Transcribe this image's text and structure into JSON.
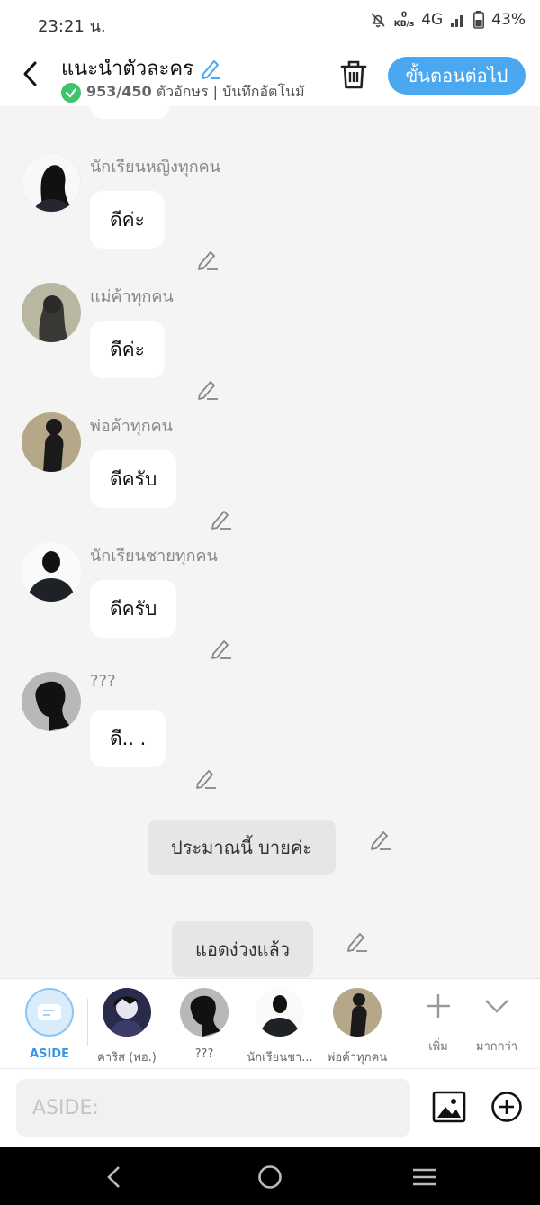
{
  "status": {
    "time": "23:21 น.",
    "speed_top": "0",
    "speed_bottom": "KB/s",
    "network": "4G",
    "battery": "43%"
  },
  "header": {
    "title": "แนะนำตัวละคร",
    "char_count": "953/450",
    "char_label": "ตัวอักษร",
    "autosave": "| บันทึกอัตโนมั",
    "next_label": "ขั้นตอนต่อไป"
  },
  "messages": [
    {
      "sender": "นักเรียนหญิงทุกคน",
      "text": "ดีค่ะ"
    },
    {
      "sender": "แม่ค้าทุกคน",
      "text": "ดีค่ะ"
    },
    {
      "sender": "พ่อค้าทุกคน",
      "text": "ดีครับ"
    },
    {
      "sender": "นักเรียนชายทุกคน",
      "text": "ดีครับ"
    },
    {
      "sender": "???",
      "text": "ดี.. ."
    }
  ],
  "narrations": [
    {
      "text": "ประมาณนี้ บายค่ะ"
    },
    {
      "text": "แอดง่วงแล้ว"
    }
  ],
  "characters": [
    {
      "label": "ASIDE"
    },
    {
      "label": "คาริส (พอ.)"
    },
    {
      "label": "???"
    },
    {
      "label": "นักเรียนชา..."
    },
    {
      "label": "พ่อค้าทุกคน"
    }
  ],
  "tools": {
    "add_label": "เพิ่ม",
    "more_label": "มากกว่า"
  },
  "input": {
    "placeholder": "ASIDE:"
  },
  "colors": {
    "accent": "#4aa8f0",
    "check": "#3ec46d",
    "chat_bg": "#f4f4f4"
  },
  "icons": [
    "back-icon",
    "edit-pencil-icon",
    "check-icon",
    "trash-icon",
    "plus-icon",
    "chevron-down-icon",
    "image-icon",
    "add-circle-icon",
    "nav-back-icon",
    "nav-home-icon",
    "nav-recents-icon"
  ]
}
